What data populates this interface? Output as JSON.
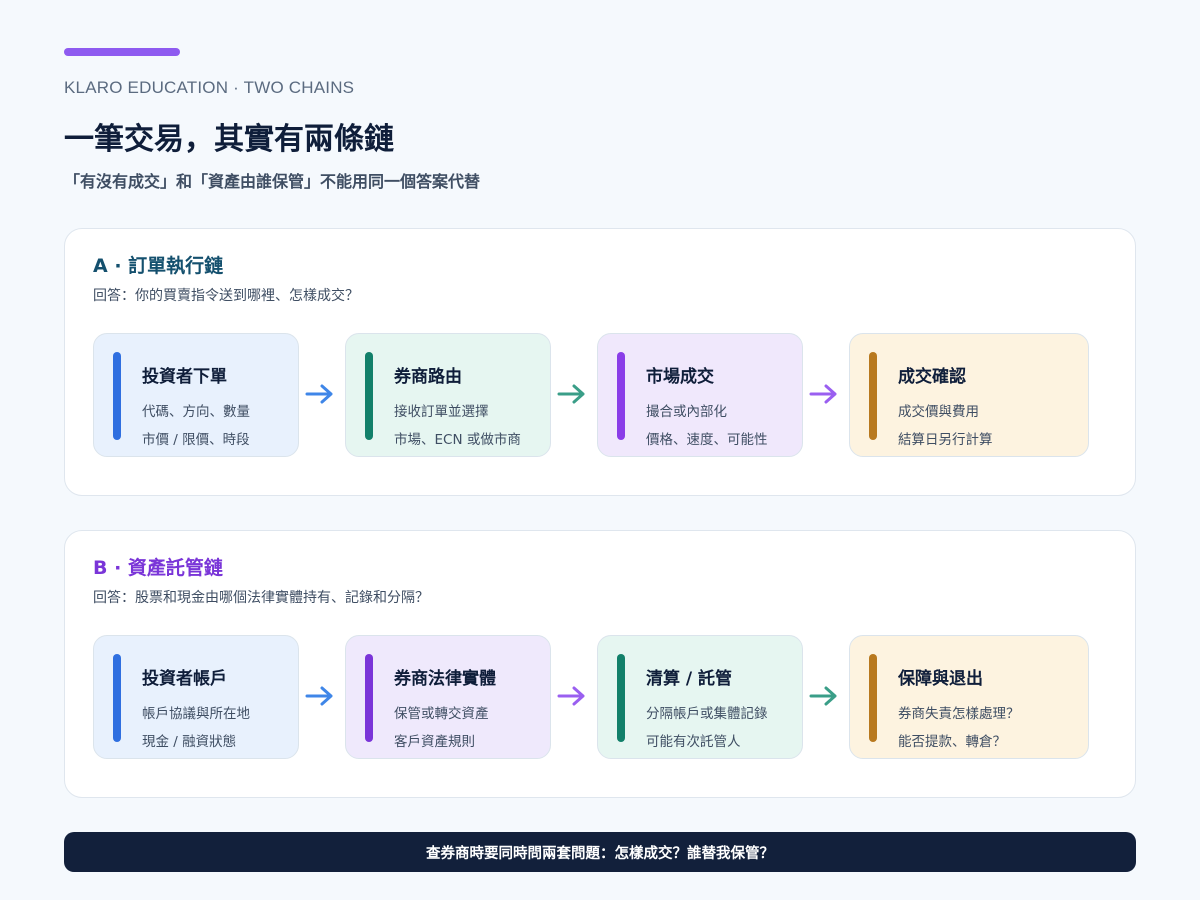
{
  "header": {
    "eyebrow": "KLARO EDUCATION · TWO CHAINS",
    "title": "一筆交易，其實有兩條鏈",
    "subtitle": "「有沒有成交」和「資產由誰保管」不能用同一個答案代替"
  },
  "colors": {
    "accent": "#8e5bf0",
    "blue": "#2f6fe0",
    "teal": "#12806a",
    "purple": "#8a3de8",
    "amber": "#b8791f"
  },
  "chains": [
    {
      "heading": "A · 訂單執行鏈",
      "question": "回答：你的買賣指令送到哪裡、怎樣成交？",
      "steps": [
        {
          "title": "投資者下單",
          "line1": "代碼、方向、數量",
          "line2": "市價 / 限價、時段",
          "stripe": "#2f6fe0",
          "bg": "#e8f1fd"
        },
        {
          "title": "券商路由",
          "line1": "接收訂單並選擇",
          "line2": "市場、ECN 或做市商",
          "stripe": "#12806a",
          "bg": "#e6f6f1"
        },
        {
          "title": "市場成交",
          "line1": "撮合或內部化",
          "line2": "價格、速度、可能性",
          "stripe": "#8a3de8",
          "bg": "#f0e8fc"
        },
        {
          "title": "成交確認",
          "line1": "成交價與費用",
          "line2": "結算日另行計算",
          "stripe": "#b8791f",
          "bg": "#fdf3e0"
        }
      ],
      "arrows": [
        "#3f86e8",
        "#3a9e88",
        "#9a5ff0"
      ]
    },
    {
      "heading": "B · 資產託管鏈",
      "question": "回答：股票和現金由哪個法律實體持有、記錄和分隔？",
      "steps": [
        {
          "title": "投資者帳戶",
          "line1": "帳戶協議與所在地",
          "line2": "現金 / 融資狀態",
          "stripe": "#2f6fe0",
          "bg": "#e8f1fd"
        },
        {
          "title": "券商法律實體",
          "line1": "保管或轉交資產",
          "line2": "客戶資產規則",
          "stripe": "#7a35d8",
          "bg": "#efe9fc"
        },
        {
          "title": "清算 / 託管",
          "line1": "分隔帳戶或集體記錄",
          "line2": "可能有次託管人",
          "stripe": "#12806a",
          "bg": "#e6f6f1"
        },
        {
          "title": "保障與退出",
          "line1": "券商失責怎樣處理？",
          "line2": "能否提款、轉倉？",
          "stripe": "#b8791f",
          "bg": "#fdf3e0"
        }
      ],
      "arrows": [
        "#3f86e8",
        "#9a5ff0",
        "#3a9e88"
      ]
    }
  ],
  "footer": {
    "text": "查券商時要同時問兩套問題：怎樣成交？誰替我保管？"
  }
}
